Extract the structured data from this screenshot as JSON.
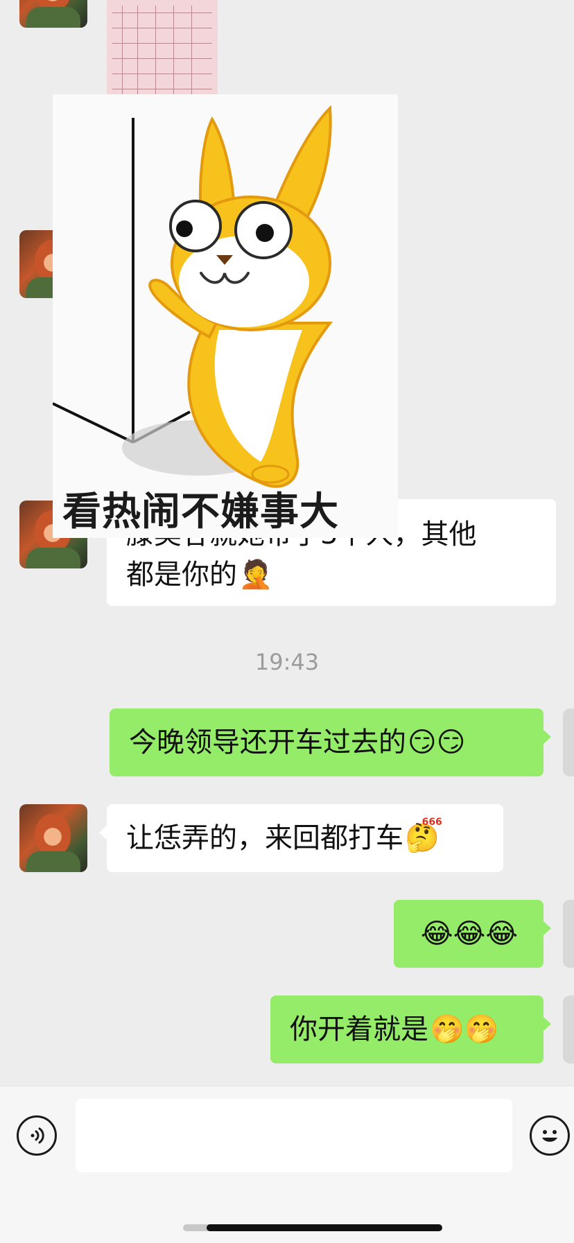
{
  "chat": {
    "sticker_caption": "看热闹不嫌事大",
    "partial_message": {
      "line1": "滕昊谷就她带了3个人，其他",
      "line2": "都是你的",
      "emoji": "🤦"
    },
    "timestamp": "19:43",
    "messages": [
      {
        "side": "out",
        "text": "今晚领导还开车过去的",
        "emoji": "😏😏"
      },
      {
        "side": "in",
        "text": "让恁弄的，来回都打车",
        "emoji": "🤔"
      },
      {
        "side": "out",
        "text": "",
        "emoji": "😂😂😂"
      },
      {
        "side": "out",
        "text": "你开着就是",
        "emoji": "🤭🤭"
      }
    ],
    "emoji_badge": "666"
  },
  "input_bar": {
    "voice_icon": "voice-icon",
    "emoji_icon": "emoji-icon",
    "input_value": ""
  },
  "colors": {
    "background": "#ededed",
    "outgoing_bubble": "#95ec69",
    "incoming_bubble": "#ffffff"
  }
}
